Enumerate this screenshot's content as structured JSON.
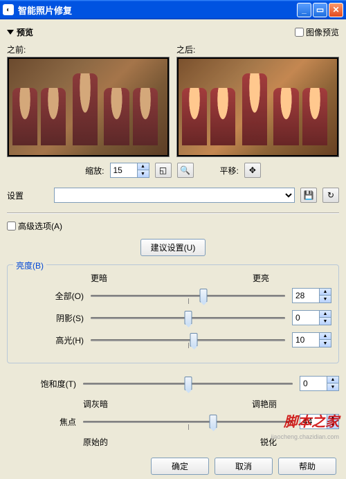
{
  "window": {
    "title": "智能照片修复"
  },
  "preview": {
    "label": "预览",
    "image_preview_label": "图像预览",
    "before_label": "之前:",
    "after_label": "之后:",
    "zoom_label": "缩放:",
    "zoom_value": "15",
    "pan_label": "平移:"
  },
  "settings_label": "设置",
  "advanced_label": "高级选项(A)",
  "suggest_button": "建议设置(U)",
  "brightness": {
    "group_title": "亮度(B)",
    "darker": "更暗",
    "brighter": "更亮",
    "rows": [
      {
        "label": "全部(O)",
        "value": "28",
        "pos": 58
      },
      {
        "label": "阴影(S)",
        "value": "0",
        "pos": 50
      },
      {
        "label": "高光(H)",
        "value": "10",
        "pos": 53
      }
    ]
  },
  "saturation": {
    "label": "饱和度(T)",
    "value": "0",
    "pos": 50,
    "gray": "调灰暗",
    "vivid": "调艳丽"
  },
  "focus": {
    "label": "焦点",
    "value": "44",
    "pos": 62,
    "original": "原始的",
    "sharpen": "锐化"
  },
  "buttons": {
    "ok": "确定",
    "cancel": "取消",
    "help": "帮助"
  },
  "watermark": "脚本之家",
  "watermark_url": "jiaocheng.chazidian.com"
}
